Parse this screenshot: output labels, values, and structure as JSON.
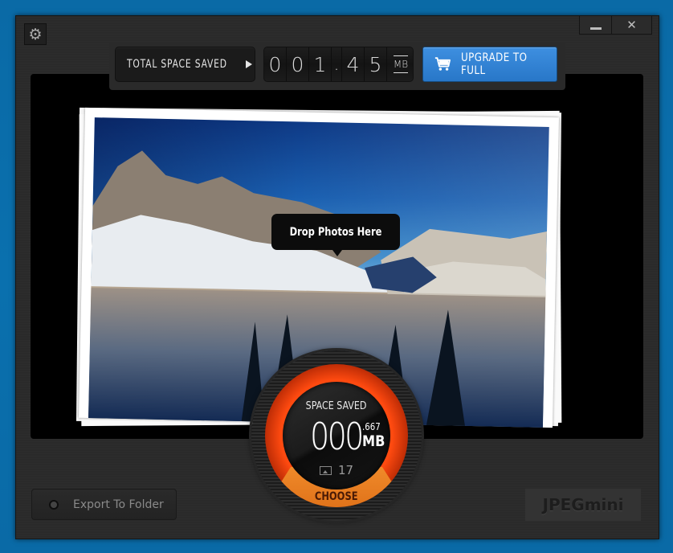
{
  "window": {
    "settings_icon": "gear-icon",
    "minimize_icon": "minimize-icon",
    "close_icon": "close-icon",
    "close_glyph": "✕",
    "settings_glyph": "⚙"
  },
  "header": {
    "total_space_saved_label": "TOTAL SPACE SAVED",
    "counter": {
      "digits": [
        "0",
        "0",
        "1",
        ".",
        "4",
        "5"
      ],
      "unit": "MB"
    },
    "upgrade_label": "UPGRADE TO FULL",
    "upgrade_icon": "cart-icon",
    "accent_color": "#2f80d3"
  },
  "drop_zone": {
    "tooltip": "Drop Photos Here"
  },
  "gauge": {
    "title": "SPACE SAVED",
    "value_integer": "000",
    "value_decimal": ".667",
    "unit": "MB",
    "photo_count": "17",
    "photo_icon": "image-icon",
    "choose_label": "CHOOSE",
    "ring_color": "#ff4a10",
    "choose_color": "#e87a20"
  },
  "footer": {
    "export_label": "Export To Folder",
    "logo_text": "JPEGmini"
  }
}
